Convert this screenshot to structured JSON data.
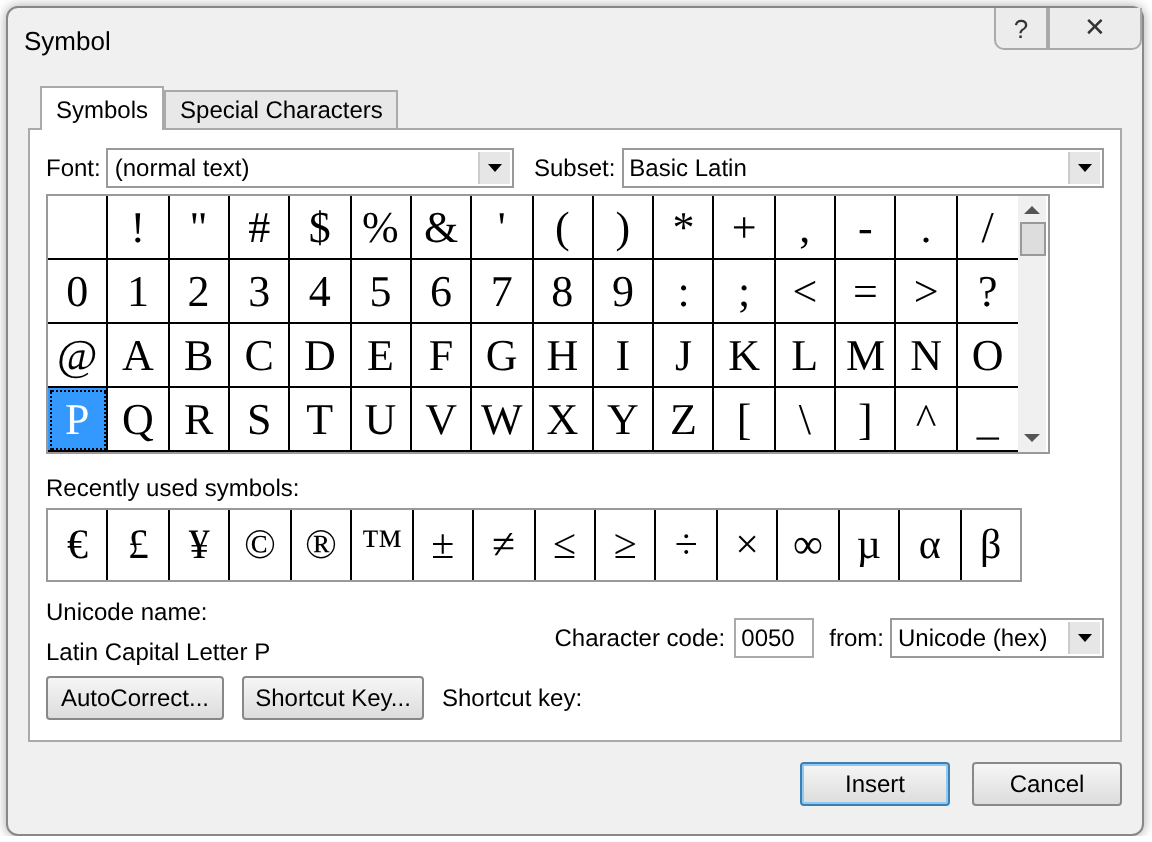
{
  "window": {
    "title": "Symbol",
    "buttons": [
      {
        "kind": "help",
        "label": "?"
      },
      {
        "kind": "close",
        "label": "✕"
      }
    ]
  },
  "tabs": [
    {
      "label": "Symbols",
      "selected": true
    },
    {
      "label": "Special Characters",
      "selected": false
    }
  ],
  "font": {
    "label": "Font:",
    "value": "(normal text)"
  },
  "subset": {
    "label": "Subset:",
    "value": "Basic Latin"
  },
  "grid": [
    [
      {
        "selected": false
      },
      {
        "char": "!",
        "selected": false
      },
      {
        "char": "\"",
        "selected": false
      },
      {
        "char": "#",
        "selected": false
      },
      {
        "char": "$",
        "selected": false
      },
      {
        "char": "%",
        "selected": false
      },
      {
        "char": "&",
        "selected": false
      },
      {
        "char": "'",
        "selected": false
      },
      {
        "char": "(",
        "selected": false
      },
      {
        "char": ")",
        "selected": false
      },
      {
        "char": "*",
        "selected": false
      },
      {
        "char": "+",
        "selected": false
      },
      {
        "char": ",",
        "selected": false
      },
      {
        "char": "-",
        "selected": false
      },
      {
        "char": ".",
        "selected": false
      },
      {
        "char": "/",
        "selected": false
      }
    ],
    [
      {
        "char": "0",
        "selected": false
      },
      {
        "char": "1",
        "selected": false
      },
      {
        "char": "2",
        "selected": false
      },
      {
        "char": "3",
        "selected": false
      },
      {
        "char": "4",
        "selected": false
      },
      {
        "char": "5",
        "selected": false
      },
      {
        "char": "6",
        "selected": false
      },
      {
        "char": "7",
        "selected": false
      },
      {
        "char": "8",
        "selected": false
      },
      {
        "char": "9",
        "selected": false
      },
      {
        "char": ":",
        "selected": false
      },
      {
        "char": ";",
        "selected": false
      },
      {
        "char": "<",
        "selected": false
      },
      {
        "char": "=",
        "selected": false
      },
      {
        "char": ">",
        "selected": false
      },
      {
        "char": "?",
        "selected": false
      }
    ],
    [
      {
        "char": "@",
        "selected": false
      },
      {
        "char": "A",
        "selected": false
      },
      {
        "char": "B",
        "selected": false
      },
      {
        "char": "C",
        "selected": false
      },
      {
        "char": "D",
        "selected": false
      },
      {
        "char": "E",
        "selected": false
      },
      {
        "char": "F",
        "selected": false
      },
      {
        "char": "G",
        "selected": false
      },
      {
        "char": "H",
        "selected": false
      },
      {
        "char": "I",
        "selected": false
      },
      {
        "char": "J",
        "selected": false
      },
      {
        "char": "K",
        "selected": false
      },
      {
        "char": "L",
        "selected": false
      },
      {
        "char": "M",
        "selected": false
      },
      {
        "char": "N",
        "selected": false
      },
      {
        "char": "O",
        "selected": false
      }
    ],
    [
      {
        "char": "P",
        "selected": true
      },
      {
        "char": "Q",
        "selected": false
      },
      {
        "char": "R",
        "selected": false
      },
      {
        "char": "S",
        "selected": false
      },
      {
        "char": "T",
        "selected": false
      },
      {
        "char": "U",
        "selected": false
      },
      {
        "char": "V",
        "selected": false
      },
      {
        "char": "W",
        "selected": false
      },
      {
        "char": "X",
        "selected": false
      },
      {
        "char": "Y",
        "selected": false
      },
      {
        "char": "Z",
        "selected": false
      },
      {
        "char": "[",
        "selected": false
      },
      {
        "char": "\\",
        "selected": false
      },
      {
        "char": "]",
        "selected": false
      },
      {
        "char": "^",
        "selected": false
      },
      {
        "char": "_",
        "selected": false
      }
    ]
  ],
  "recent": {
    "label": "Recently used symbols:",
    "symbols": [
      "€",
      "£",
      "¥",
      "©",
      "®",
      "™",
      "±",
      "≠",
      "≤",
      "≥",
      "÷",
      "×",
      "∞",
      "µ",
      "α",
      "β"
    ]
  },
  "unicode_name": {
    "label": "Unicode name:",
    "value": "Latin Capital Letter P"
  },
  "character_code": {
    "label": "Character code:",
    "value": "0050"
  },
  "from": {
    "label": "from:",
    "value": "Unicode (hex)"
  },
  "actions": [
    "AutoCorrect...",
    "Shortcut Key..."
  ],
  "shortcut_key": {
    "label": "Shortcut key:"
  },
  "footer_buttons": [
    {
      "label": "Insert",
      "default": true
    },
    {
      "label": "Cancel",
      "default": false
    }
  ]
}
